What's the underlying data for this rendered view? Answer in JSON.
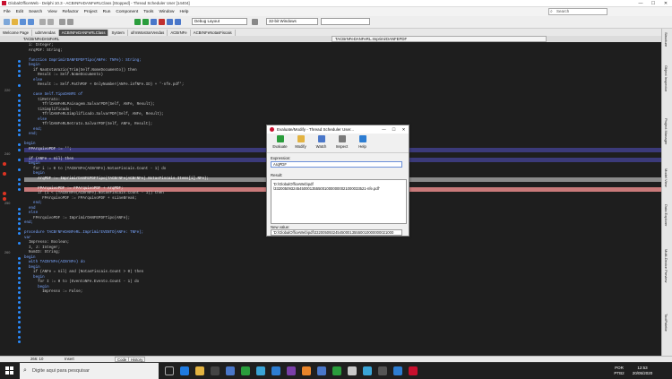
{
  "window": {
    "title": "GlobalOfficeWeb - Delphi 10.3 - ACBrNFeDANFeRLClass [Stopped] - Thread Scheduler User [14404]",
    "minimize": "—",
    "maximize": "☐",
    "close": "✕"
  },
  "menu": [
    "File",
    "Edit",
    "Search",
    "View",
    "Refactor",
    "Project",
    "Run",
    "Component",
    "Tools",
    "Window",
    "Help"
  ],
  "search": {
    "placeholder": "Search"
  },
  "toolbar": {
    "layout": "Debug Layout",
    "platform": "32-bit Windows"
  },
  "tabs": [
    "Welcome Page",
    "udmVendas",
    "ACBrNFeDANFeRLClass",
    "System",
    "ufrmMostrarVendas",
    "ACBrNFe",
    "ACBrNFeNotasFiscais"
  ],
  "active_tab": 2,
  "subtabs": {
    "class": "TACBrNFeDANFeRL",
    "method": "TACBrNFeDANFeRL.ImprimirDANFEPDF"
  },
  "gutter": [
    {
      "n": "",
      "dot": false,
      "bp": false
    },
    {
      "n": "",
      "dot": false,
      "bp": false
    },
    {
      "n": "",
      "dot": false,
      "bp": false
    },
    {
      "n": "",
      "dot": true,
      "bp": false
    },
    {
      "n": "",
      "dot": true,
      "bp": false
    },
    {
      "n": "",
      "dot": true,
      "bp": false
    },
    {
      "n": "",
      "dot": true,
      "bp": false
    },
    {
      "n": "",
      "dot": false,
      "bp": false
    },
    {
      "n": "",
      "dot": true,
      "bp": false
    },
    {
      "n": "220",
      "dot": false,
      "bp": false
    },
    {
      "n": "",
      "dot": true,
      "bp": false
    },
    {
      "n": "",
      "dot": true,
      "bp": false
    },
    {
      "n": "",
      "dot": true,
      "bp": false
    },
    {
      "n": "",
      "dot": true,
      "bp": false
    },
    {
      "n": "",
      "dot": true,
      "bp": false
    },
    {
      "n": "",
      "dot": true,
      "bp": false
    },
    {
      "n": "",
      "dot": true,
      "bp": false
    },
    {
      "n": "",
      "dot": true,
      "bp": false
    },
    {
      "n": "",
      "dot": true,
      "bp": false
    },
    {
      "n": "",
      "dot": false,
      "bp": false
    },
    {
      "n": "",
      "dot": true,
      "bp": false
    },
    {
      "n": "",
      "dot": true,
      "bp": false
    },
    {
      "n": "240",
      "dot": false,
      "bp": false
    },
    {
      "n": "",
      "dot": true,
      "bp": false
    },
    {
      "n": "",
      "dot": false,
      "bp": true
    },
    {
      "n": "",
      "dot": true,
      "bp": false
    },
    {
      "n": "",
      "dot": false,
      "bp": true
    },
    {
      "n": "",
      "dot": true,
      "bp": false
    },
    {
      "n": "",
      "dot": true,
      "bp": false
    },
    {
      "n": "",
      "dot": true,
      "bp": false
    },
    {
      "n": "",
      "dot": false,
      "bp": true
    },
    {
      "n": "",
      "dot": false,
      "bp": true
    },
    {
      "n": "250",
      "dot": false,
      "bp": false
    },
    {
      "n": "",
      "dot": true,
      "bp": false
    },
    {
      "n": "",
      "dot": true,
      "bp": false
    },
    {
      "n": "",
      "dot": true,
      "bp": false
    },
    {
      "n": "",
      "dot": true,
      "bp": false
    },
    {
      "n": "",
      "dot": true,
      "bp": false
    },
    {
      "n": "",
      "dot": true,
      "bp": false
    },
    {
      "n": "",
      "dot": false,
      "bp": false
    },
    {
      "n": "",
      "dot": true,
      "bp": false
    },
    {
      "n": "",
      "dot": false,
      "bp": false
    },
    {
      "n": "260",
      "dot": false,
      "bp": false
    },
    {
      "n": "",
      "dot": true,
      "bp": false
    },
    {
      "n": "",
      "dot": true,
      "bp": false
    },
    {
      "n": "",
      "dot": true,
      "bp": false
    },
    {
      "n": "",
      "dot": true,
      "bp": false
    },
    {
      "n": "",
      "dot": true,
      "bp": false
    },
    {
      "n": "",
      "dot": true,
      "bp": false
    },
    {
      "n": "",
      "dot": true,
      "bp": false
    },
    {
      "n": "",
      "dot": true,
      "bp": false
    },
    {
      "n": "",
      "dot": true,
      "bp": false
    },
    {
      "n": "",
      "dot": true,
      "bp": false
    },
    {
      "n": "",
      "dot": true,
      "bp": false
    },
    {
      "n": "",
      "dot": true,
      "bp": false
    },
    {
      "n": "",
      "dot": true,
      "bp": false
    },
    {
      "n": "",
      "dot": true,
      "bp": false
    },
    {
      "n": "",
      "dot": true,
      "bp": false
    },
    {
      "n": "",
      "dot": true,
      "bp": false
    },
    {
      "n": "",
      "dot": true,
      "bp": false
    },
    {
      "n": "",
      "dot": true,
      "bp": false
    }
  ],
  "code": [
    {
      "t": "  i: Integer;",
      "c": ""
    },
    {
      "t": "  ArqPDF: String;",
      "c": ""
    },
    {
      "t": "",
      "c": ""
    },
    {
      "t": "  function ImprimirDANFEPDFTipo(ANFe: TNFe): String;",
      "c": "kw"
    },
    {
      "t": "  begin",
      "c": "kw"
    },
    {
      "t": "    if NaoEstaVazio(Trim(Self.NomeDocumento)) then",
      "c": ""
    },
    {
      "t": "      Result := Self.NomeDocumento)",
      "c": ""
    },
    {
      "t": "    else",
      "c": "kw"
    },
    {
      "t": "      Result := Self.PathPDF + OnlyNumber(ANFe.infNFe.ID) + '-nfe.pdf';",
      "c": ""
    },
    {
      "t": "",
      "c": ""
    },
    {
      "t": "    case Self.TipoDANFE of",
      "c": "kw"
    },
    {
      "t": "      tiRetrato:",
      "c": ""
    },
    {
      "t": "        TfrlDANFeRLPaisagem.SalvarPDF(Self, ANFe, Result);",
      "c": ""
    },
    {
      "t": "      tiSimplificado:",
      "c": ""
    },
    {
      "t": "        TfrlDANFeRLSimplificado.SalvarPDF(Self, ANFe, Result);",
      "c": ""
    },
    {
      "t": "      else",
      "c": "kw"
    },
    {
      "t": "        TfrlDANFeRLRetrato.SalvarPDF(Self, ANFe, Result);",
      "c": ""
    },
    {
      "t": "    end;",
      "c": "kw"
    },
    {
      "t": "  end;",
      "c": "kw"
    },
    {
      "t": "",
      "c": ""
    },
    {
      "t": "begin",
      "c": "kw"
    },
    {
      "t": "  FPArquivoPDF := '';",
      "c": "hl-blue"
    },
    {
      "t": "",
      "c": ""
    },
    {
      "t": "  if (ANFe = nil) then",
      "c": "hl-blue"
    },
    {
      "t": "  begin",
      "c": "kw"
    },
    {
      "t": "    for i := 0 to (TACBrNFe(ACBrNFe).NotasFiscais.Count - 1) do",
      "c": ""
    },
    {
      "t": "    begin",
      "c": "kw"
    },
    {
      "t": "      ArqPDF := ImprimirDANFEPDFTipo(TACBrNFe(ACBrNFe).NotasFiscais.Items[i].NFe);",
      "c": "hl-sel"
    },
    {
      "t": "",
      "c": ""
    },
    {
      "t": "      FPArquivoPDF := FPArquivoPDF + ArqPDF;",
      "c": "hl-red"
    },
    {
      "t": "      if (i < (TACBrNFe(ACBrNFe).NotasFiscais.Count - 1)) then",
      "c": ""
    },
    {
      "t": "        FPArquivoPDF := FPArquivoPDF + sLineBreak;",
      "c": ""
    },
    {
      "t": "    end;",
      "c": "kw"
    },
    {
      "t": "  end",
      "c": "kw"
    },
    {
      "t": "  else",
      "c": "kw"
    },
    {
      "t": "    FPArquivoPDF := ImprimirDANFEPDFTipo(ANFe);",
      "c": ""
    },
    {
      "t": "end;",
      "c": "kw"
    },
    {
      "t": "",
      "c": ""
    },
    {
      "t": "procedure TACBrNFeDANFeRL.ImprimirEVENTO(ANFe: TNFe);",
      "c": "kw"
    },
    {
      "t": "var",
      "c": "kw"
    },
    {
      "t": "  Impresso: Boolean;",
      "c": ""
    },
    {
      "t": "  I, J: Integer;",
      "c": ""
    },
    {
      "t": "  NumID: String;",
      "c": ""
    },
    {
      "t": "begin",
      "c": "kw"
    },
    {
      "t": "  with TACBrNFe(ACBrNFe) do",
      "c": "kw"
    },
    {
      "t": "  begin",
      "c": "kw"
    },
    {
      "t": "    if (ANFe = nil) and (NotasFiscais.Count > 0) then",
      "c": ""
    },
    {
      "t": "    begin",
      "c": "kw"
    },
    {
      "t": "      for I := 0 to (EventoNFe.Evento.Count - 1) do",
      "c": ""
    },
    {
      "t": "      begin",
      "c": "kw"
    },
    {
      "t": "        Impresso := False;",
      "c": ""
    }
  ],
  "rightbar": [
    "Structure",
    "Object Inspector",
    "Project Manager",
    "Model View",
    "Data Explorer",
    "Multi-Device Preview",
    "ToolPalette"
  ],
  "status": {
    "pos": "266: 10",
    "mode": "Insert",
    "code_tab": "Code",
    "history_tab": "History"
  },
  "taskbar": {
    "search_placeholder": "Digite aqui para pesquisar",
    "lang1": "POR",
    "lang2": "PTB2",
    "time": "12:53",
    "date": "20/05/2020"
  },
  "dialog": {
    "title": "Evaluate/Modify - Thread Scheduler User...",
    "tools": [
      "Evaluate",
      "Modify",
      "Watch",
      "Inspect",
      "Help"
    ],
    "expression_label": "Expression:",
    "expression_value": "ArqPDF",
    "result_label": "Result:",
    "result_lines": [
      "'D:\\GlobalOfficeWeb\\pdf",
      "\\33200509324545000135550010000000021000033521-nfe.pdf'"
    ],
    "new_value_label": "New value:",
    "new_value": "'D:\\GlobalOfficeWeb\\pdf\\33200509324545000135550010000000021000"
  },
  "colors": {
    "accent": "#c8102e",
    "editor_bg": "#1e1e1e",
    "selection": "#3b3a7a",
    "breakpoint_line": "#c97a7a"
  }
}
